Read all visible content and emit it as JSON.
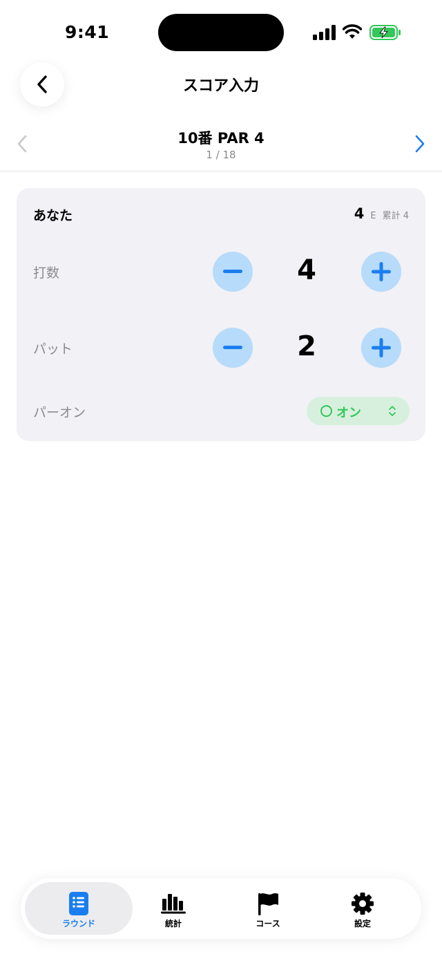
{
  "status": {
    "time": "9:41"
  },
  "header": {
    "title": "スコア入力"
  },
  "hole": {
    "title": "10番  PAR 4",
    "progress": "1 / 18"
  },
  "player": {
    "name": "あなた",
    "score_total": "4",
    "score_relative": "E",
    "score_cumulative": "累計 4",
    "strokes_label": "打数",
    "strokes_value": "4",
    "putts_label": "パット",
    "putts_value": "2",
    "gir_label": "パーオン",
    "gir_value": "オン"
  },
  "tabs": [
    {
      "label": "ラウンド",
      "icon": "list-icon",
      "active": true
    },
    {
      "label": "統計",
      "icon": "chart-icon",
      "active": false
    },
    {
      "label": "コース",
      "icon": "flag-icon",
      "active": false
    },
    {
      "label": "設定",
      "icon": "gear-icon",
      "active": false
    }
  ],
  "colors": {
    "accent": "#1a7ef0",
    "stepper_bg": "#b7dbfa",
    "gir_green": "#34c759",
    "card_bg": "#f1f1f6"
  }
}
